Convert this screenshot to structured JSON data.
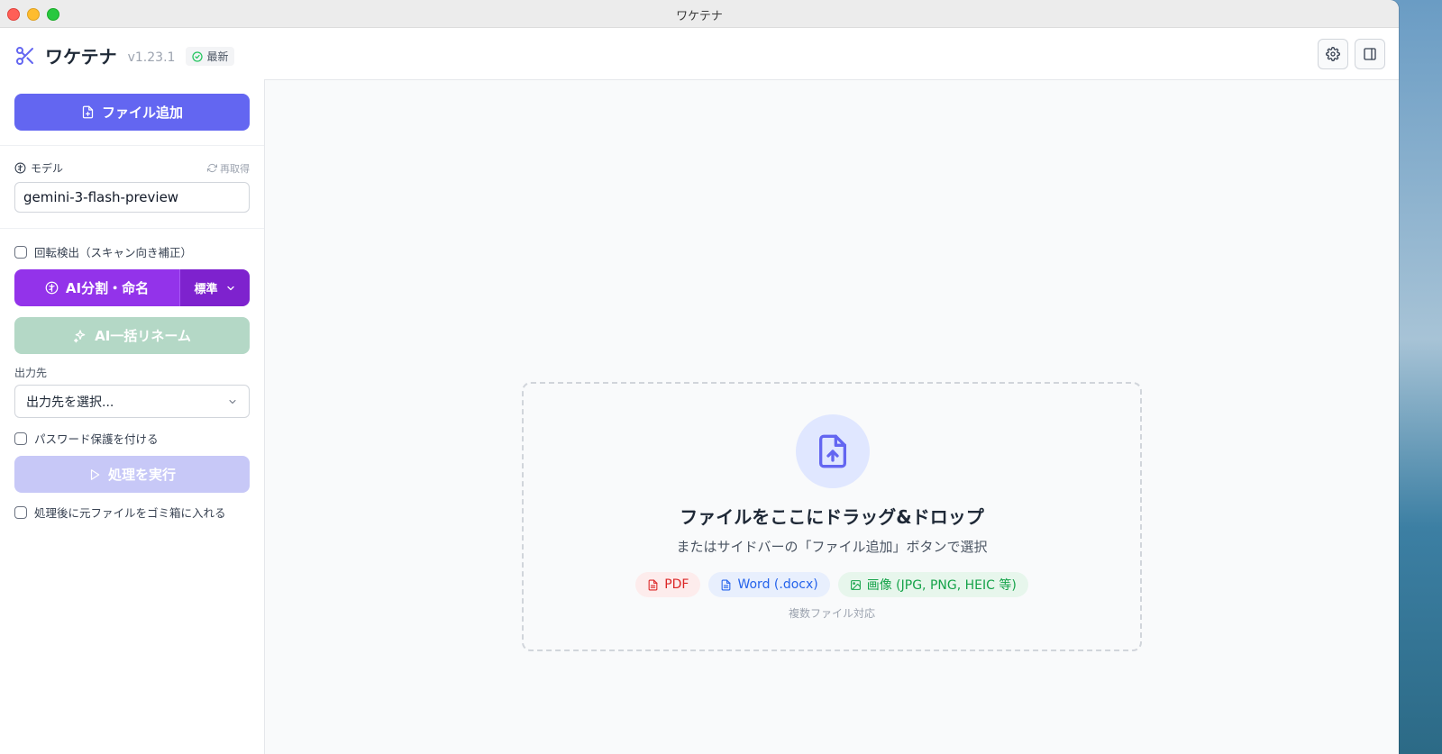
{
  "window": {
    "title": "ワケテナ"
  },
  "header": {
    "app_name": "ワケテナ",
    "version": "v1.23.1",
    "badge": "最新",
    "icons": {
      "brand": "scissors-icon",
      "settings": "gear-icon",
      "panel": "sidebar-panel-icon"
    }
  },
  "sidebar": {
    "add_file_label": "ファイル追加",
    "model": {
      "label": "モデル",
      "refetch_label": "再取得",
      "value": "gemini-3-flash-preview"
    },
    "rotation_check_label": "回転検出（スキャン向き補正）",
    "ai_split_label": "AI分割・命名",
    "ai_split_mode": "標準",
    "ai_rename_label": "AI一括リネーム",
    "output": {
      "label": "出力先",
      "placeholder": "出力先を選択..."
    },
    "password_label": "パスワード保護を付ける",
    "run_label": "処理を実行",
    "trash_label": "処理後に元ファイルをゴミ箱に入れる"
  },
  "dropzone": {
    "title": "ファイルをここにドラッグ&ドロップ",
    "subtitle": "またはサイドバーの「ファイル追加」ボタンで選択",
    "chips": {
      "pdf": "PDF",
      "word": "Word (.docx)",
      "image": "画像 (JPG, PNG, HEIC 等)"
    },
    "note": "複数ファイル対応"
  },
  "colors": {
    "accent": "#6366f1",
    "purple": "#9333ea",
    "rename_disabled": "#b4d8c6",
    "run_disabled": "#c7c8f7"
  }
}
